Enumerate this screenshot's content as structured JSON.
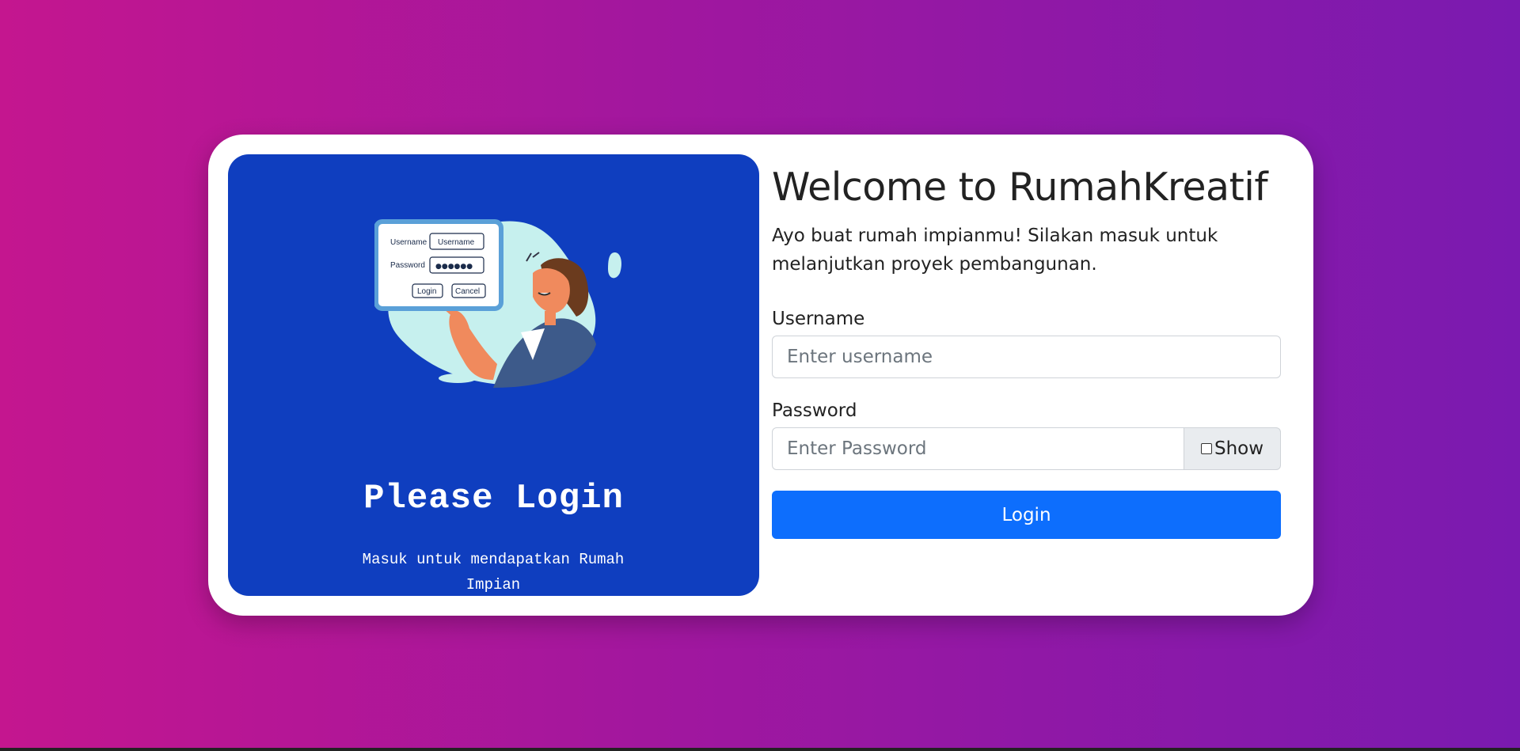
{
  "left": {
    "title": "Please Login",
    "subtitle": "Masuk untuk mendapatkan Rumah Impian",
    "illustration": {
      "username_label": "Username",
      "username_value": "Username",
      "password_label": "Password",
      "password_value": "●●●●●●",
      "login_label": "Login",
      "cancel_label": "Cancel"
    }
  },
  "right": {
    "title": "Welcome to RumahKreatif",
    "intro": "Ayo buat rumah impianmu! Silakan masuk untuk melanjutkan proyek pembangunan.",
    "username_label": "Username",
    "username_placeholder": "Enter username",
    "password_label": "Password",
    "password_placeholder": "Enter Password",
    "show_label": "Show",
    "login_label": "Login"
  },
  "colors": {
    "panel": "#0f3ebf",
    "primary": "#0d6efd"
  }
}
